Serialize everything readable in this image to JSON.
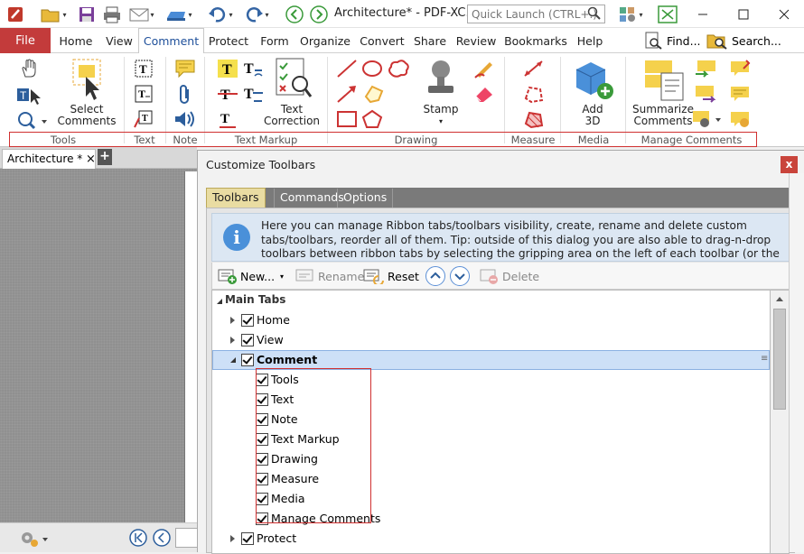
{
  "titlebar": {
    "doc_title": "Architecture* - PDF-XC...",
    "quick_launch_placeholder": "Quick Launch (CTRL+.)"
  },
  "ribbon_tabs": {
    "file": "File",
    "tabs": [
      "Home",
      "View",
      "Comment",
      "Protect",
      "Form",
      "Organize",
      "Convert",
      "Share",
      "Review",
      "Bookmarks",
      "Help"
    ],
    "active": "Comment",
    "find": "Find...",
    "search": "Search..."
  },
  "ribbon": {
    "select_comments": [
      "Select",
      "Comments"
    ],
    "text_correction": [
      "Text",
      "Correction"
    ],
    "stamp": "Stamp",
    "add_3d": [
      "Add",
      "3D"
    ],
    "summarize": [
      "Summarize",
      "Comments"
    ],
    "groups": [
      "Tools",
      "Text",
      "Note",
      "Text Markup",
      "Drawing",
      "Measure",
      "Media",
      "Manage Comments"
    ]
  },
  "doctab": {
    "label": "Architecture *",
    "close": "×",
    "add": "+"
  },
  "dialog": {
    "title": "Customize Toolbars",
    "close": "x",
    "tabs": [
      "Toolbars",
      "Commands",
      "Options"
    ],
    "info": "Here you can manage Ribbon tabs/toolbars visibility, create, rename and delete custom tabs/toolbars, reorder all of them. Tip: outside of this dialog you are also able to drag-n-drop toolbars between ribbon tabs by selecting the gripping area on the left of each toolbar (or the toolbar's caption if toolbar is not docked).",
    "toolbar": {
      "new": "New...",
      "rename": "Rename",
      "reset": "Reset",
      "delete": "Delete"
    },
    "tree": {
      "root": "Main Tabs",
      "items": [
        {
          "label": "Home",
          "level": 1,
          "expanded": false
        },
        {
          "label": "View",
          "level": 1,
          "expanded": false
        },
        {
          "label": "Comment",
          "level": 1,
          "expanded": true,
          "selected": true
        },
        {
          "label": "Tools",
          "level": 2
        },
        {
          "label": "Text",
          "level": 2
        },
        {
          "label": "Note",
          "level": 2
        },
        {
          "label": "Text Markup",
          "level": 2
        },
        {
          "label": "Drawing",
          "level": 2
        },
        {
          "label": "Measure",
          "level": 2
        },
        {
          "label": "Media",
          "level": 2
        },
        {
          "label": "Manage Comments",
          "level": 2
        },
        {
          "label": "Protect",
          "level": 1,
          "expanded": false
        }
      ]
    }
  },
  "colors": {
    "file_tab": "#c33b3b",
    "selection": "#cde0f7",
    "highlight_box": "#d03030",
    "info_bg": "#dce7f3"
  }
}
